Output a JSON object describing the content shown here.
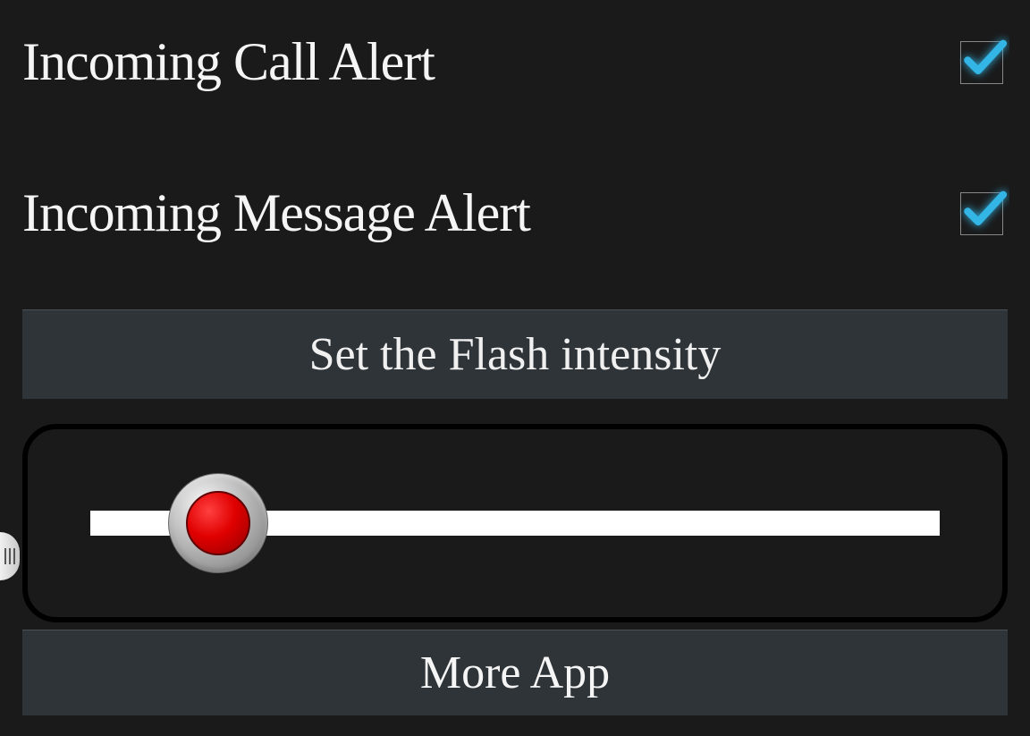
{
  "settings": {
    "incoming_call": {
      "label": "Incoming Call Alert",
      "checked": true
    },
    "incoming_message": {
      "label": "Incoming Message Alert",
      "checked": true
    }
  },
  "flash_intensity": {
    "header": "Set the Flash intensity",
    "value_percent": 15
  },
  "more_app_label": "More App",
  "colors": {
    "check": "#33b5e5",
    "thumb": "#e00000"
  }
}
